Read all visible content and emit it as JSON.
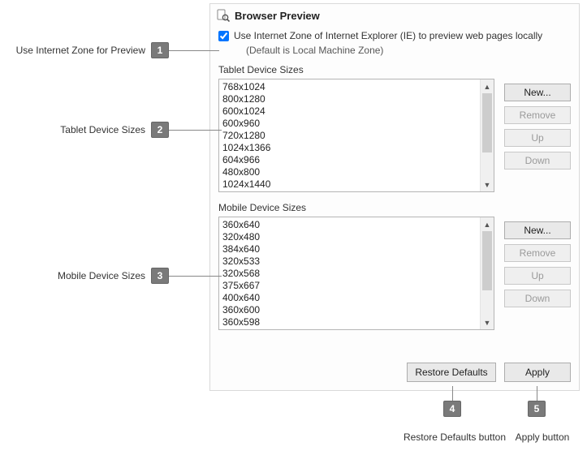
{
  "header": {
    "title": "Browser Preview"
  },
  "checkbox": {
    "checked": true,
    "label": "Use Internet Zone of Internet Explorer (IE) to preview web pages locally",
    "note": "(Default is Local Machine Zone)"
  },
  "tablet": {
    "label": "Tablet Device Sizes",
    "items": [
      "768x1024",
      "800x1280",
      "600x1024",
      "600x960",
      "720x1280",
      "1024x1366",
      "604x966",
      "480x800",
      "1024x1440"
    ],
    "buttons": {
      "new": "New...",
      "remove": "Remove",
      "up": "Up",
      "down": "Down"
    }
  },
  "mobile": {
    "label": "Mobile Device Sizes",
    "items": [
      "360x640",
      "320x480",
      "384x640",
      "320x533",
      "320x568",
      "375x667",
      "400x640",
      "360x600",
      "360x598"
    ],
    "buttons": {
      "new": "New...",
      "remove": "Remove",
      "up": "Up",
      "down": "Down"
    }
  },
  "footer": {
    "restore": "Restore Defaults",
    "apply": "Apply"
  },
  "callouts": {
    "c1": {
      "num": "1",
      "text": "Use Internet Zone for Preview"
    },
    "c2": {
      "num": "2",
      "text": "Tablet Device Sizes"
    },
    "c3": {
      "num": "3",
      "text": "Mobile Device Sizes"
    },
    "c4": {
      "num": "4",
      "text": "Restore Defaults button"
    },
    "c5": {
      "num": "5",
      "text": "Apply button"
    }
  }
}
